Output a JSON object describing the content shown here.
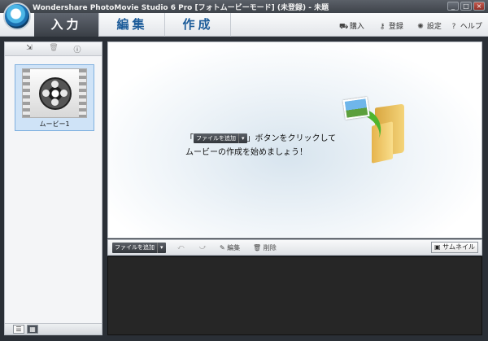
{
  "window": {
    "title": "Wondershare PhotoMovie Studio 6 Pro [フォトムービーモード] (未登録) - 未題",
    "minimize": "_",
    "maximize": "□",
    "close": "×"
  },
  "tabs": [
    {
      "label": "入力",
      "active": true
    },
    {
      "label": "編集",
      "active": false
    },
    {
      "label": "作成",
      "active": false
    }
  ],
  "nav_links": {
    "buy": "購入",
    "register": "登録",
    "settings": "設定",
    "help": "ヘルプ"
  },
  "left_panel": {
    "media_items": [
      {
        "label": "ムービー1"
      }
    ]
  },
  "preview": {
    "message_prefix": "「",
    "message_button": "ファイルを追加",
    "message_line1_suffix": "」ボタンをクリックして",
    "message_line2": "ムービーの作成を始めましょう！"
  },
  "timeline_toolbar": {
    "add_file": "ファイルを追加",
    "edit": "編集",
    "delete": "削除",
    "thumbnail": "サムネイル"
  },
  "colors": {
    "accent_blue": "#1b5b99",
    "active_tab": "#4b5159",
    "timeline_bg": "#262626",
    "arrow_green": "#4db52e"
  }
}
